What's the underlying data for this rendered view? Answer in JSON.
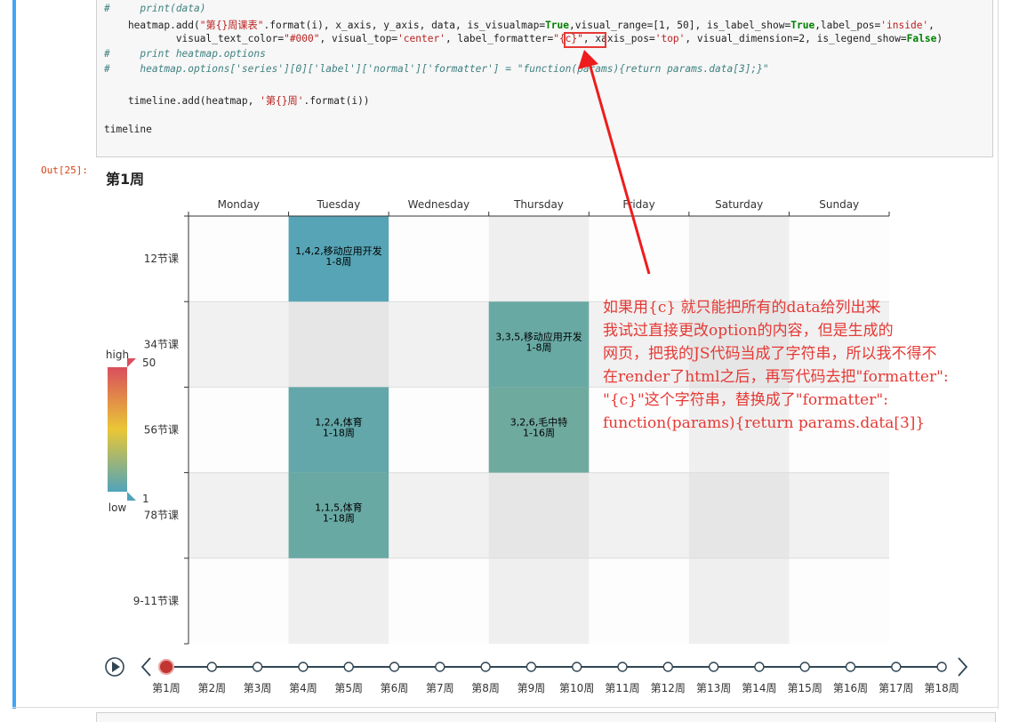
{
  "code": {
    "lines": [
      {
        "kind": "comment",
        "text": "#     print(data)"
      },
      {
        "kind": "mixed",
        "parts": [
          {
            "t": "    heatmap.add(",
            "c": ""
          },
          {
            "t": "\"第{}周课表\"",
            "c": "s"
          },
          {
            "t": ".format(i), x_axis, y_axis, data, is_visualmap=",
            "c": ""
          },
          {
            "t": "True",
            "c": "k"
          },
          {
            "t": ",visual_range=[1, 50], is_label_show=",
            "c": ""
          },
          {
            "t": "True",
            "c": "k"
          },
          {
            "t": ",label_pos=",
            "c": ""
          },
          {
            "t": "'inside'",
            "c": "s"
          },
          {
            "t": ",",
            "c": ""
          }
        ]
      },
      {
        "kind": "mixed",
        "parts": [
          {
            "t": "            visual_text_color=",
            "c": ""
          },
          {
            "t": "\"#000\"",
            "c": "s"
          },
          {
            "t": ", visual_top=",
            "c": ""
          },
          {
            "t": "'center'",
            "c": "s"
          },
          {
            "t": ", label_formatter=",
            "c": ""
          },
          {
            "t": "\"{c}\"",
            "c": "s"
          },
          {
            "t": ", xaxis_pos=",
            "c": ""
          },
          {
            "t": "'top'",
            "c": "s"
          },
          {
            "t": ", visual_dimension=2, is_legend_show=",
            "c": ""
          },
          {
            "t": "False",
            "c": "k"
          },
          {
            "t": ")",
            "c": ""
          }
        ]
      },
      {
        "kind": "comment",
        "text": "#     print heatmap.options"
      },
      {
        "kind": "comment",
        "text": "#     heatmap.options['series'][0]['label']['normal']['formatter'] = \"function(params){return params.data[3];}\""
      },
      {
        "kind": "blank",
        "text": ""
      },
      {
        "kind": "mixed",
        "parts": [
          {
            "t": "    timeline.add(heatmap, ",
            "c": ""
          },
          {
            "t": "'第{}周'",
            "c": "s"
          },
          {
            "t": ".format(i))",
            "c": ""
          }
        ]
      },
      {
        "kind": "blank",
        "text": ""
      },
      {
        "kind": "plain",
        "text": "timeline"
      }
    ]
  },
  "output": {
    "prompt": "Out[25]:",
    "title": "第1周"
  },
  "chart_data": {
    "type": "heatmap",
    "title": "第1周",
    "x_categories": [
      "Monday",
      "Tuesday",
      "Wednesday",
      "Thursday",
      "Friday",
      "Saturday",
      "Sunday"
    ],
    "y_categories": [
      "12节课",
      "34节课",
      "56节课",
      "78节课",
      "9-11节课"
    ],
    "cells": [
      {
        "x": 1,
        "y": 0,
        "value": 2,
        "label_lines": [
          "1,4,2,移动应用开发",
          "1-8周"
        ]
      },
      {
        "x": 3,
        "y": 1,
        "value": 5,
        "label_lines": [
          "3,3,5,移动应用开发",
          "1-8周"
        ]
      },
      {
        "x": 1,
        "y": 2,
        "value": 4,
        "label_lines": [
          "1,2,4,体育",
          "1-18周"
        ]
      },
      {
        "x": 3,
        "y": 2,
        "value": 6,
        "label_lines": [
          "3,2,6,毛中特",
          "1-16周"
        ]
      },
      {
        "x": 1,
        "y": 3,
        "value": 5,
        "label_lines": [
          "1,1,5,体育",
          "1-18周"
        ]
      }
    ],
    "visual_map": {
      "min": 1,
      "max": 50,
      "high_label": "high",
      "low_label": "low",
      "colors": [
        "#50a3ba",
        "#eac736",
        "#d94e5d"
      ]
    },
    "timeline": {
      "labels": [
        "第1周",
        "第2周",
        "第3周",
        "第4周",
        "第5周",
        "第6周",
        "第7周",
        "第8周",
        "第9周",
        "第10周",
        "第11周",
        "第12周",
        "第13周",
        "第14周",
        "第15周",
        "第16周",
        "第17周",
        "第18周"
      ],
      "current": 0,
      "active_color": "#c23531",
      "line_color": "#304654"
    }
  },
  "annotation": {
    "lines": [
      "如果用{c} 就只能把所有的data给列出来",
      "我试过直接更改option的内容，但是生成的",
      "网页，把我的JS代码当成了字符串，所以我不得不",
      "在render了html之后，再写代码去把\"formatter\":",
      "\"{c}\"这个字符串，替换成了\"formatter\":",
      "function(params){return params.data[3]}"
    ],
    "color": "#e53935"
  }
}
